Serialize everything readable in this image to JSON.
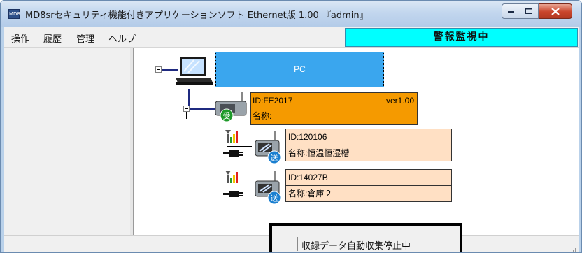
{
  "window": {
    "title": "MD8srセキュリティ機能付きアプリケーションソフト Ethernet版 1.00 『admin』",
    "icon": "app-icon",
    "icon_label": "MD8"
  },
  "menu": {
    "items": [
      "操作",
      "履歴",
      "管理",
      "ヘルプ"
    ]
  },
  "alarm": {
    "label": "警報監視中",
    "color": "#00ffff"
  },
  "tree": {
    "pc": {
      "label": "PC",
      "icon": "laptop-icon",
      "color": "#3aa6ee"
    },
    "receiver": {
      "id": "ID:FE2017",
      "version": "ver1.00",
      "name": "名称:",
      "badge": "受",
      "icon": "receiver-icon",
      "color": "#f59a00"
    },
    "transmitters": [
      {
        "id": "ID:120106",
        "name": "名称:恒温恒湿槽",
        "badge": "送",
        "icon": "transmitter-icon"
      },
      {
        "id": "ID:14027B",
        "name": "名称:倉庫２",
        "badge": "送",
        "icon": "transmitter-icon"
      }
    ]
  },
  "status": {
    "text": "収録データ自動収集停止中"
  }
}
